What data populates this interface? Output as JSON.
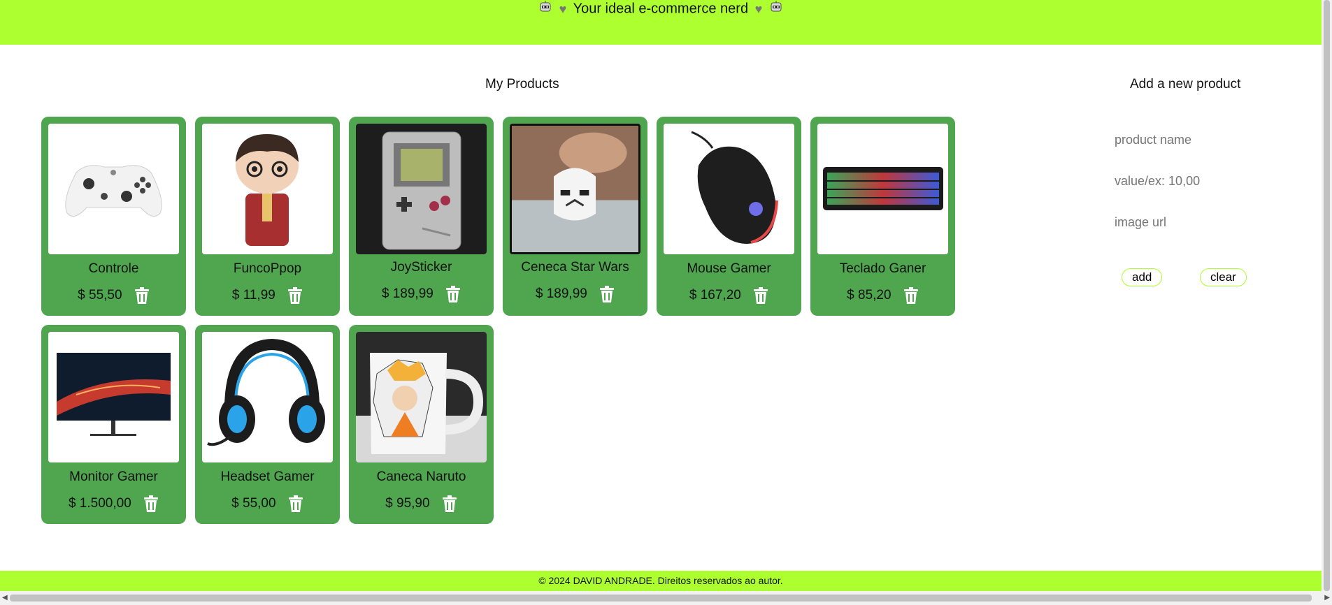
{
  "header": {
    "title": "Your ideal e-commerce nerd"
  },
  "products_title": "My Products",
  "form": {
    "title": "Add a new product",
    "name_placeholder": "product name",
    "value_placeholder": "value/ex: 10,00",
    "image_placeholder": "image url",
    "add_label": "add",
    "clear_label": "clear"
  },
  "products": [
    {
      "name": "Controle",
      "price": "$ 55,50",
      "image": "xbox-controller"
    },
    {
      "name": "FuncoPpop",
      "price": "$ 11,99",
      "image": "funko-pop-figure"
    },
    {
      "name": "JoySticker",
      "price": "$ 189,99",
      "image": "game-boy"
    },
    {
      "name": "Ceneca Star Wars",
      "price": "$ 189,99",
      "image": "stormtrooper-mug"
    },
    {
      "name": "Mouse Gamer",
      "price": "$ 167,20",
      "image": "gaming-mouse"
    },
    {
      "name": "Teclado Ganer",
      "price": "$ 85,20",
      "image": "gaming-keyboard"
    },
    {
      "name": "Monitor Gamer",
      "price": "$ 1.500,00",
      "image": "gaming-monitor"
    },
    {
      "name": "Headset Gamer",
      "price": "$ 55,00",
      "image": "gaming-headset"
    },
    {
      "name": "Caneca Naruto",
      "price": "$ 95,90",
      "image": "naruto-mug"
    }
  ],
  "footer": {
    "text": "© 2024 DAVID ANDRADE. Direitos reservados ao autor."
  },
  "colors": {
    "accent": "#adff2f",
    "card": "#4fa64f"
  }
}
